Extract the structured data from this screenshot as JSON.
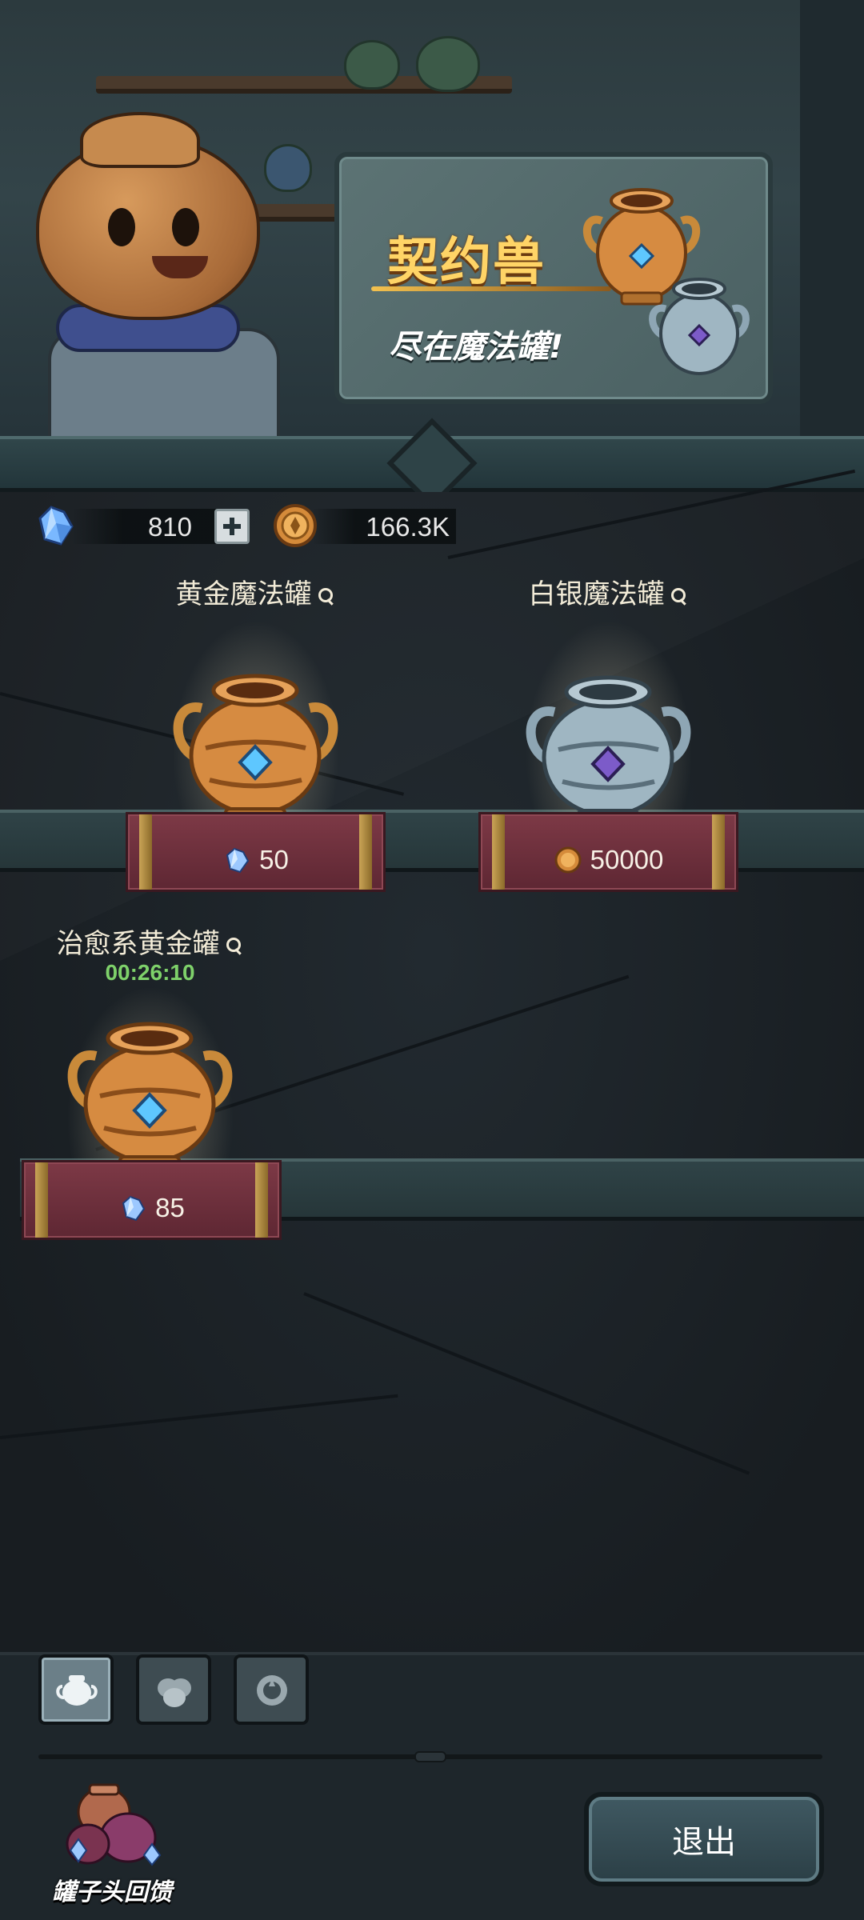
{
  "banner": {
    "title": "契约兽",
    "subtitle": "尽在魔法罐!"
  },
  "currency": {
    "gems": "810",
    "coins": "166.3K"
  },
  "jars": [
    {
      "name": "黄金魔法罐",
      "price": "50",
      "price_icon": "gem-icon",
      "type": "gold"
    },
    {
      "name": "白银魔法罐",
      "price": "50000",
      "price_icon": "coin-icon",
      "type": "silver"
    },
    {
      "name": "治愈系黄金罐",
      "timer": "00:26:10",
      "price": "85",
      "price_icon": "gem-icon",
      "type": "gold"
    }
  ],
  "tabs": [
    {
      "name": "single-jar-tab",
      "active": true
    },
    {
      "name": "multi-jar-tab",
      "active": false
    },
    {
      "name": "emblem-tab",
      "active": false
    }
  ],
  "feedback": {
    "label": "罐子头回馈"
  },
  "exit": {
    "label": "退出"
  },
  "colors": {
    "gold_text": "#ffd466",
    "timer_green": "#7ed16a",
    "price_box": "#6e2f3c",
    "background": "#1b2126"
  }
}
